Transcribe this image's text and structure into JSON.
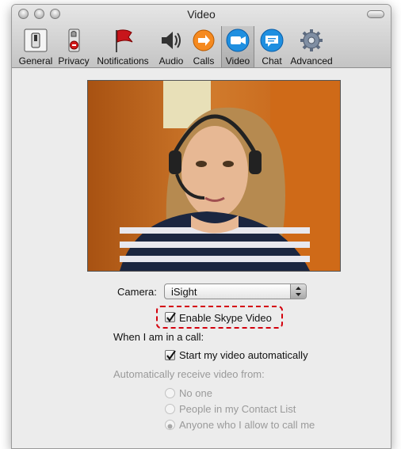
{
  "window": {
    "title": "Video"
  },
  "toolbar": {
    "items": [
      {
        "label": "General",
        "icon": "general-switch-icon"
      },
      {
        "label": "Privacy",
        "icon": "privacy-lock-icon"
      },
      {
        "label": "Notifications",
        "icon": "flag-icon"
      },
      {
        "label": "Audio",
        "icon": "speaker-icon"
      },
      {
        "label": "Calls",
        "icon": "calls-icon"
      },
      {
        "label": "Video",
        "icon": "video-camera-icon",
        "selected": true
      },
      {
        "label": "Chat",
        "icon": "chat-icon"
      },
      {
        "label": "Advanced",
        "icon": "gear-icon"
      }
    ]
  },
  "camera": {
    "label": "Camera:",
    "selected": "iSight"
  },
  "enable_video": {
    "label": "Enable Skype Video",
    "checked": true
  },
  "in_call": {
    "heading": "When I am in a call:",
    "start_video": {
      "label": "Start my video automatically",
      "checked": true
    }
  },
  "receive": {
    "heading": "Automatically receive video from:",
    "options": [
      {
        "label": "No one",
        "selected": false
      },
      {
        "label": "People in my Contact List",
        "selected": false
      },
      {
        "label": "Anyone who I allow to call me",
        "selected": true
      }
    ]
  },
  "colors": {
    "highlight": "#d4000d",
    "accent_blue": "#1e8fe0"
  }
}
